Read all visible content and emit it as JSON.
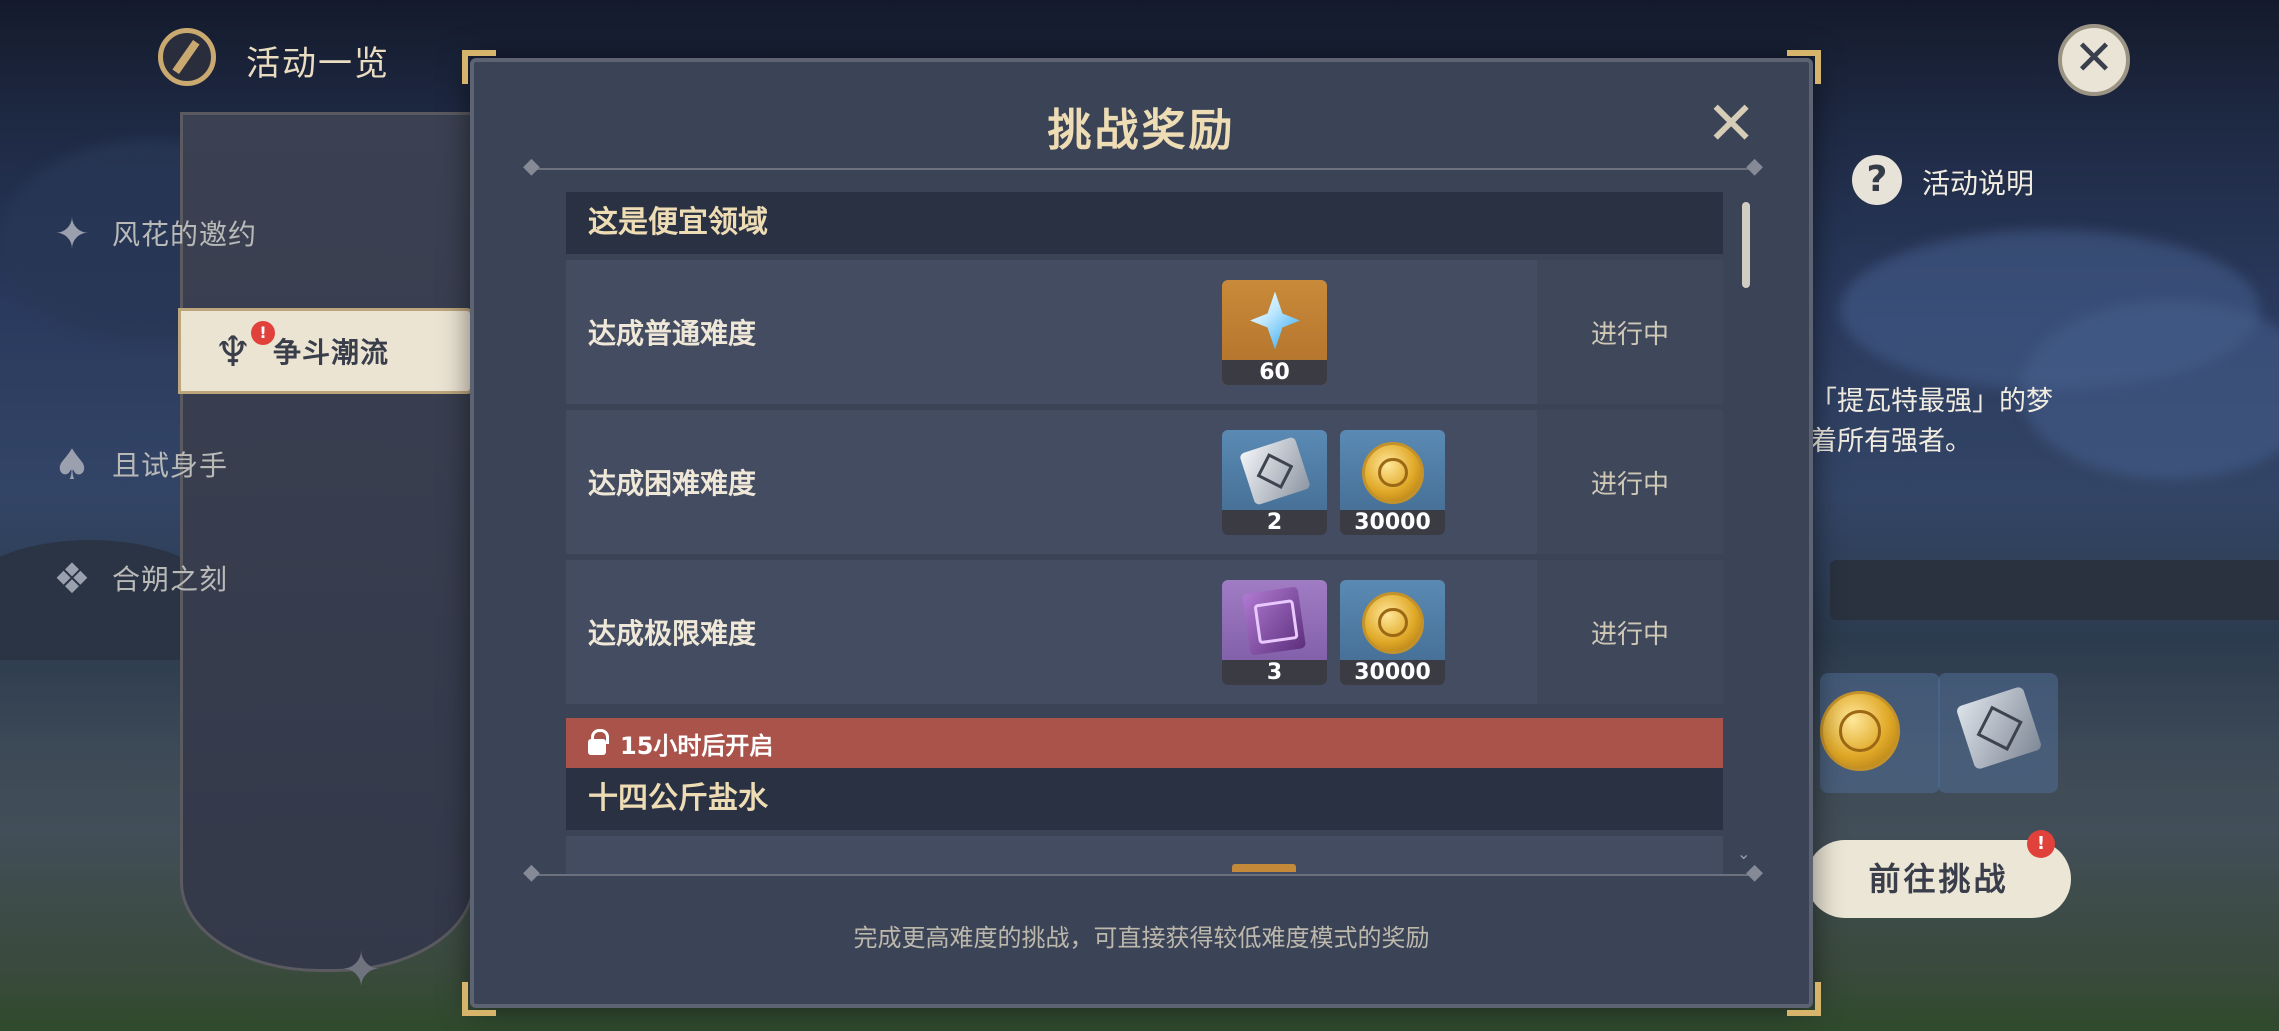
{
  "header": {
    "title": "活动一览"
  },
  "sidebar": {
    "items": [
      {
        "label": "风花的邀约",
        "icon": "flower-star-icon"
      },
      {
        "label": "争斗潮流",
        "icon": "warrior-icon"
      },
      {
        "label": "且试身手",
        "icon": "cards-icon"
      },
      {
        "label": "合朔之刻",
        "icon": "ornament-icon"
      }
    ],
    "active_badge": "!"
  },
  "background": {
    "help_label": "活动说明",
    "help_icon": "?",
    "desc_line1": "「提瓦特最强」的梦",
    "desc_line2": "着所有强者。",
    "go_button": "前往挑战",
    "go_badge": "!"
  },
  "dialog": {
    "title": "挑战奖励",
    "close_glyph": "✕",
    "sections": [
      {
        "name": "这是便宜领域",
        "rows": [
          {
            "task": "达成普通难度",
            "status": "进行中",
            "rewards": [
              {
                "icon": "primogem-icon",
                "count": "60"
              }
            ]
          },
          {
            "task": "达成困难难度",
            "status": "进行中",
            "rewards": [
              {
                "icon": "exp-book-icon",
                "count": "2"
              },
              {
                "icon": "mora-coin-icon",
                "count": "30000"
              }
            ]
          },
          {
            "task": "达成极限难度",
            "status": "进行中",
            "rewards": [
              {
                "icon": "purple-book-icon",
                "count": "3"
              },
              {
                "icon": "mora-coin-icon",
                "count": "30000"
              }
            ]
          }
        ]
      },
      {
        "lock_text": "15小时后开启",
        "name": "十四公斤盐水"
      }
    ],
    "footer": "完成更高难度的挑战，可直接获得较低难度模式的奖励"
  }
}
